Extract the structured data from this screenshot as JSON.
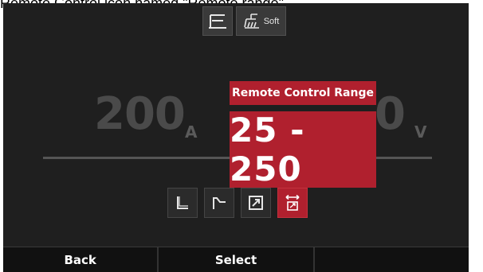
{
  "caption": "Remote Control icon named \"Remote range\".",
  "top_icons": [
    {
      "name": "torch-icon"
    },
    {
      "name": "soft-start-icon",
      "label": "Soft"
    }
  ],
  "readouts": {
    "current_value": "200",
    "current_unit": "A",
    "voltage_value": "0",
    "voltage_unit": "V"
  },
  "popup": {
    "title": "Remote Control Range",
    "value": "25 - 250"
  },
  "mode_icons": [
    {
      "name": "step-icon",
      "active": false
    },
    {
      "name": "ramp-icon",
      "active": false
    },
    {
      "name": "expand-icon",
      "active": false
    },
    {
      "name": "remote-range-icon",
      "active": true
    }
  ],
  "softkeys": {
    "back": "Back",
    "select": "Select",
    "empty": ""
  },
  "colors": {
    "accent": "#b0202e",
    "screen_bg": "#1f1f1f"
  }
}
